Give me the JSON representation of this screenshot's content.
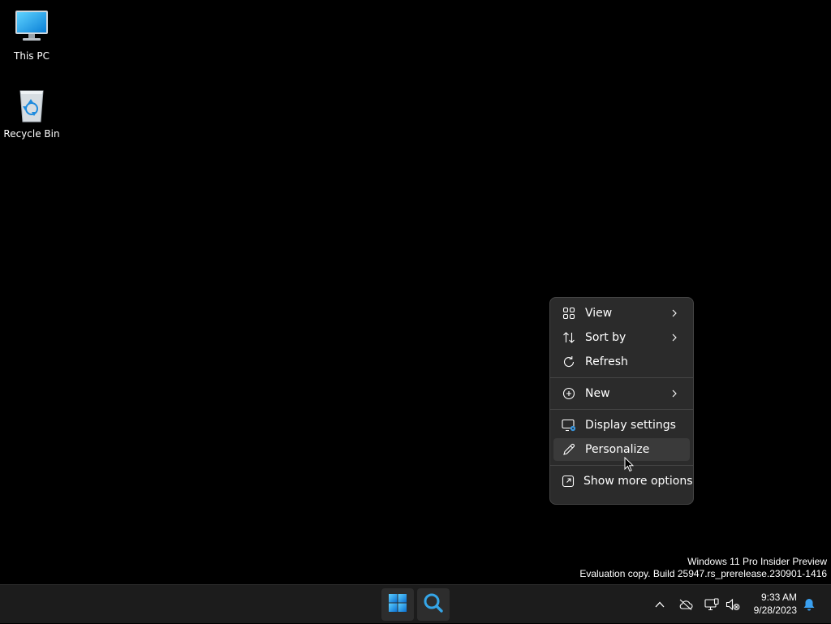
{
  "desktop": {
    "icons": [
      {
        "label": "This PC",
        "icon": "monitor-icon"
      },
      {
        "label": "Recycle Bin",
        "icon": "recycle-bin-icon"
      }
    ]
  },
  "context_menu": {
    "items": [
      {
        "label": "View",
        "icon": "grid-view-icon",
        "submenu": true
      },
      {
        "label": "Sort by",
        "icon": "sort-arrows-icon",
        "submenu": true
      },
      {
        "label": "Refresh",
        "icon": "refresh-icon",
        "submenu": false
      },
      {
        "label": "New",
        "icon": "plus-circle-icon",
        "submenu": true
      },
      {
        "label": "Display settings",
        "icon": "display-settings-icon",
        "submenu": false
      },
      {
        "label": "Personalize",
        "icon": "pen-icon",
        "submenu": false,
        "hovered": true
      },
      {
        "label": "Show more options",
        "icon": "expand-icon",
        "submenu": false
      }
    ]
  },
  "watermark": {
    "line1": "Windows 11 Pro Insider Preview",
    "line2": "Evaluation copy. Build 25947.rs_prerelease.230901-1416"
  },
  "taskbar": {
    "start_icon": "windows-logo-icon",
    "search_icon": "search-icon",
    "tray_icons": [
      "chevron-up-icon",
      "cloud-offline-icon",
      "network-icon",
      "volume-muted-icon"
    ],
    "time": "9:33 AM",
    "date": "9/28/2023",
    "notification_icon": "bell-icon"
  },
  "colors": {
    "desktop_bg": "#000000",
    "menu_bg": "#2b2b2b",
    "menu_hover": "#3a3a3a",
    "taskbar_bg": "#1c1c1c",
    "accent": "#0078d4"
  }
}
